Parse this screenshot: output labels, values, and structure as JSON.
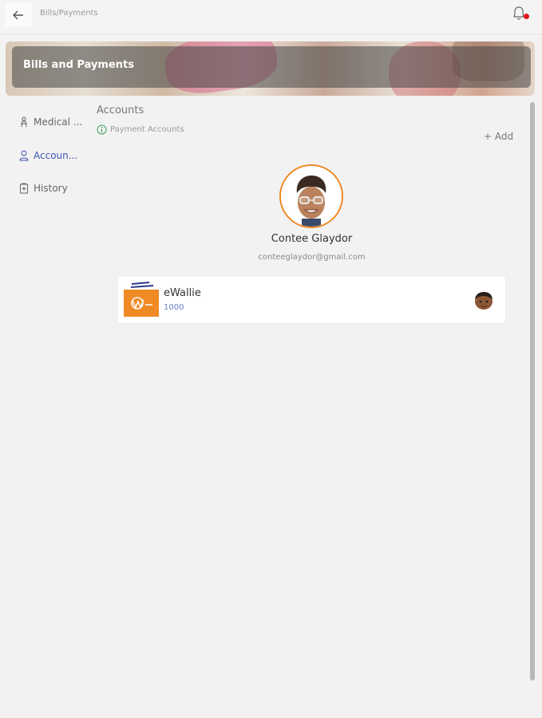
{
  "topbar": {
    "breadcrumb": "Bills/Payments",
    "icons": [
      "arrow-left-icon",
      "bell-icon"
    ],
    "notification_dot_color": "#e0151a"
  },
  "banner": {
    "title": "Bills and Payments"
  },
  "sidebar": {
    "items": [
      {
        "label": "Medical ...",
        "icon": "medical-icon",
        "active": false
      },
      {
        "label": "Accoun...",
        "icon": "user-icon",
        "active": true
      },
      {
        "label": "History",
        "icon": "history-icon",
        "active": false
      }
    ],
    "active_color": "#3b55b0"
  },
  "main": {
    "section_title": "Accounts",
    "sub_label": "Payment Accounts",
    "add_label": "+ Add",
    "profile": {
      "name": "Contee Glaydor",
      "email": "conteeglaydor@gmail.com",
      "ring_color": "#f08620"
    },
    "accounts": [
      {
        "name": "eWallie",
        "number": "1000",
        "logo_color": "#f08a24",
        "logo_text": "eWallie"
      }
    ]
  }
}
